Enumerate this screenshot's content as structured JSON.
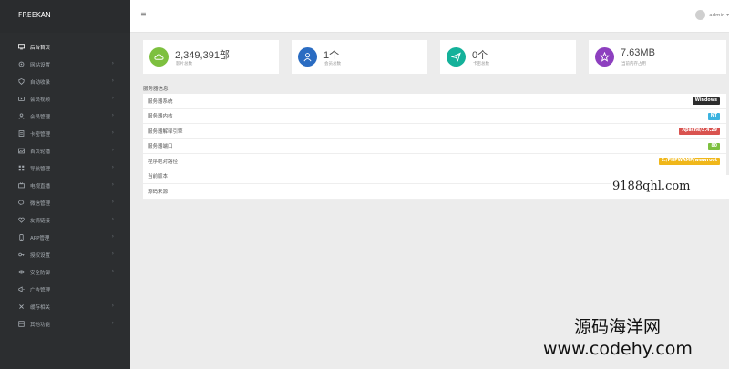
{
  "brand": "FREEKAN",
  "nav": [
    {
      "label": "后台首页",
      "icon": "monitor-icon",
      "active": true,
      "chevron": ""
    },
    {
      "label": "网站设置",
      "icon": "gear-icon",
      "active": false,
      "chevron": "›"
    },
    {
      "label": "自动收录",
      "icon": "shield-icon",
      "active": false,
      "chevron": "›"
    },
    {
      "label": "会员视频",
      "icon": "video-icon",
      "active": false,
      "chevron": "›"
    },
    {
      "label": "会员管理",
      "icon": "user-icon",
      "active": false,
      "chevron": "›"
    },
    {
      "label": "卡密管理",
      "icon": "card-icon",
      "active": false,
      "chevron": "›"
    },
    {
      "label": "首页轮播",
      "icon": "image-icon",
      "active": false,
      "chevron": "›"
    },
    {
      "label": "导航管理",
      "icon": "grid-icon",
      "active": false,
      "chevron": "›"
    },
    {
      "label": "电视直播",
      "icon": "tv-icon",
      "active": false,
      "chevron": "›"
    },
    {
      "label": "微信管理",
      "icon": "wechat-icon",
      "active": false,
      "chevron": "›"
    },
    {
      "label": "友情链接",
      "icon": "heart-icon",
      "active": false,
      "chevron": "›"
    },
    {
      "label": "APP管理",
      "icon": "app-icon",
      "active": false,
      "chevron": "›"
    },
    {
      "label": "授权设置",
      "icon": "key-icon",
      "active": false,
      "chevron": "›"
    },
    {
      "label": "安全防御",
      "icon": "eye-icon",
      "active": false,
      "chevron": "›"
    },
    {
      "label": "广告管理",
      "icon": "bullhorn-icon",
      "active": false,
      "chevron": ""
    },
    {
      "label": "缓存相关",
      "icon": "cache-icon",
      "active": false,
      "chevron": "›"
    },
    {
      "label": "其他功能",
      "icon": "tools-icon",
      "active": false,
      "chevron": "›"
    }
  ],
  "topbar": {
    "menu_icon": "≡",
    "user": "admin ▾"
  },
  "stats": [
    {
      "value": "2,349,391部",
      "label": "影片总数",
      "color": "#7dc03f",
      "icon": "cloud-icon"
    },
    {
      "value": "1个",
      "label": "会员总数",
      "color": "#2a6cc2",
      "icon": "user-icon"
    },
    {
      "value": "0个",
      "label": "卡密总数",
      "color": "#14b19a",
      "icon": "send-icon"
    },
    {
      "value": "7.63MB",
      "label": "当前内存占用",
      "color": "#8d3fbf",
      "icon": "star-icon"
    }
  ],
  "server": {
    "title": "服务器信息",
    "rows": [
      {
        "label": "服务器系统",
        "badge": "Windows",
        "badge_color": "#2d2d2d"
      },
      {
        "label": "服务器内核",
        "badge": "NT",
        "badge_color": "#3bb3e0"
      },
      {
        "label": "服务器解释引擎",
        "badge": "Apache/2.4.29",
        "badge_color": "#d9534f"
      },
      {
        "label": "服务器端口",
        "badge": "80",
        "badge_color": "#7dc03f"
      },
      {
        "label": "程序绝对路径",
        "badge": "E:/PHPWAMP/wwwroot",
        "badge_color": "#f0b71a"
      },
      {
        "label": "当前版本",
        "badge": "",
        "badge_color": ""
      },
      {
        "label": "源码来源",
        "badge": "",
        "badge_color": ""
      }
    ]
  },
  "watermarks": {
    "site1": "9188qhl.com",
    "site2_cn": "源码海洋网",
    "site2_url": "www.codehy.com"
  }
}
